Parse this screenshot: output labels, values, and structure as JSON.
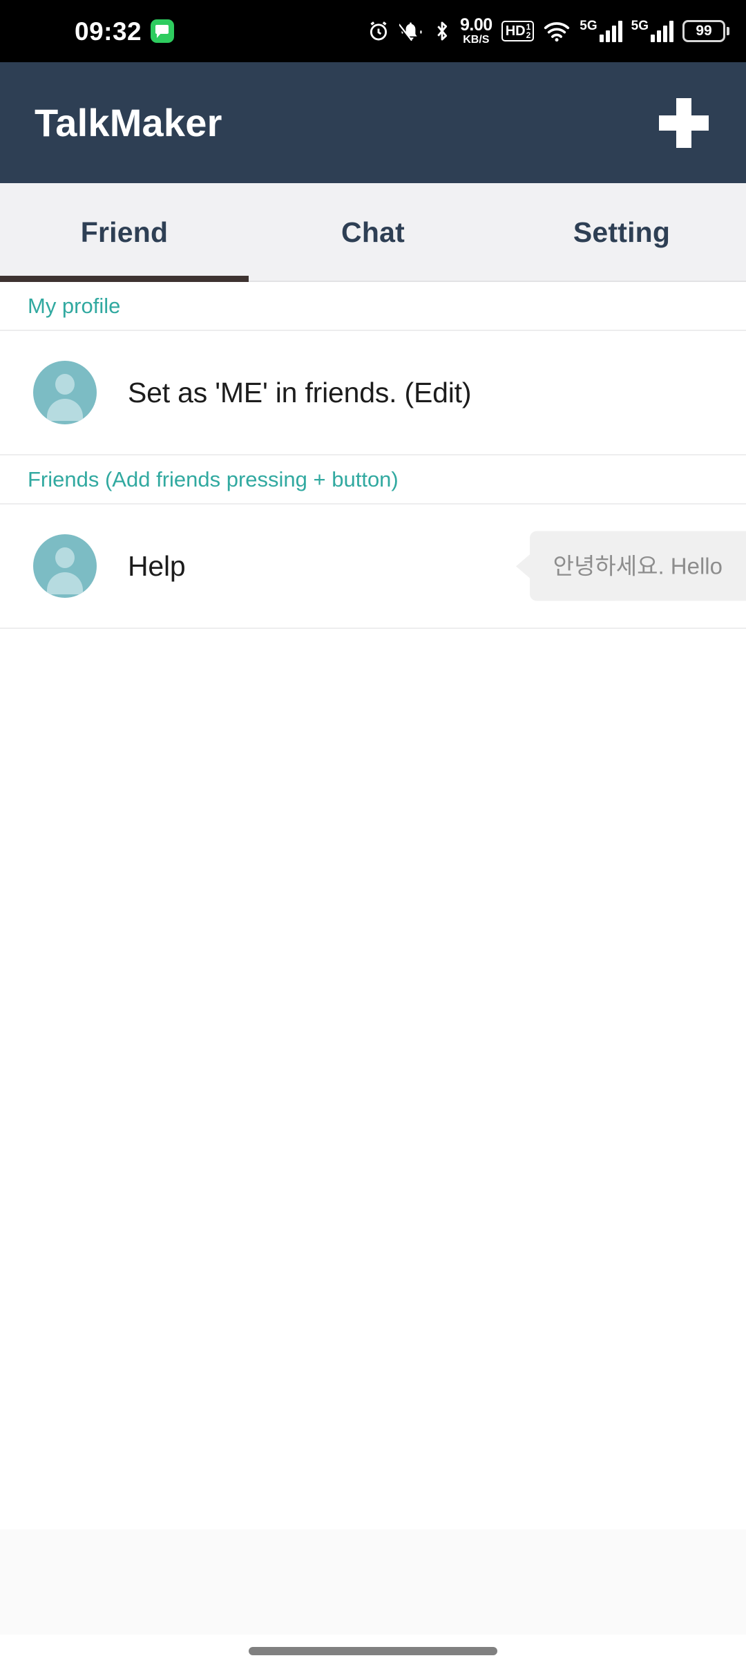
{
  "status_bar": {
    "time": "09:32",
    "notification_icon": "message-icon",
    "icons": {
      "alarm": "alarm-clock-icon",
      "mute": "bell-muted-icon",
      "bluetooth": "bluetooth-icon",
      "hd_voice": "hd-voice-icon",
      "wifi": "wifi-icon"
    },
    "net_speed_value": "9.00",
    "net_speed_unit": "KB/S",
    "hd_label": "HD",
    "hd_sub_top": "1",
    "hd_sub_bottom": "2",
    "sim1_network": "5G",
    "sim2_network": "5G",
    "battery_percent": "99"
  },
  "app_bar": {
    "title": "TalkMaker",
    "add_button_icon": "plus-icon",
    "background_color": "#2e3f54"
  },
  "tabs": {
    "items": [
      {
        "label": "Friend",
        "selected": true
      },
      {
        "label": "Chat",
        "selected": false
      },
      {
        "label": "Setting",
        "selected": false
      }
    ],
    "indicator_color": "#3e3331",
    "text_color": "#2e3f54",
    "background_color": "#f1f1f3"
  },
  "sections": [
    {
      "header": "My profile",
      "rows": [
        {
          "avatar_icon": "person-placeholder-icon",
          "label": "Set as 'ME' in friends. (Edit)",
          "preview": null
        }
      ]
    },
    {
      "header": "Friends (Add friends pressing + button)",
      "rows": [
        {
          "avatar_icon": "person-placeholder-icon",
          "label": "Help",
          "preview": "안녕하세요. Hello"
        }
      ]
    }
  ],
  "theme": {
    "accent_teal": "#31a9a0",
    "avatar_bg": "#7cbcc4",
    "avatar_fg": "#b6dbe0",
    "bubble_bg": "#f0f0f0",
    "bubble_text": "#8d8d8d",
    "divider": "#ededee"
  },
  "bottom": {
    "band_color": "#fafafa",
    "gesture_bar": "home-indicator"
  }
}
